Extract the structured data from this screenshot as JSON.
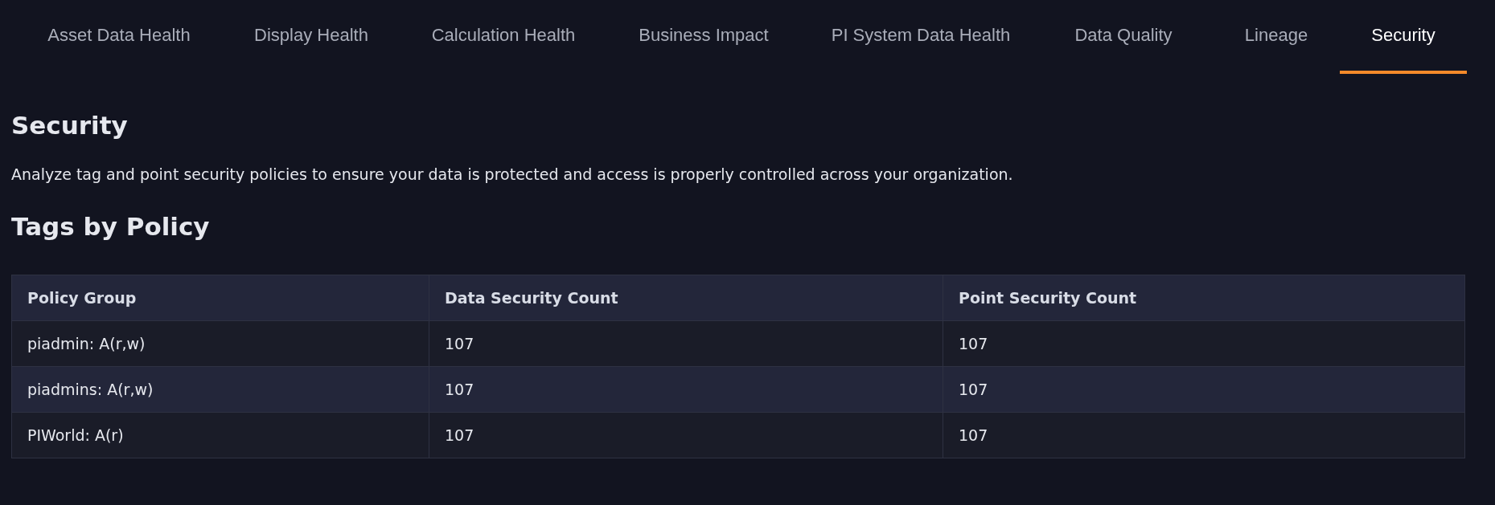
{
  "tabs": [
    {
      "label": "Asset Data Health",
      "selected": false
    },
    {
      "label": "Display Health",
      "selected": false
    },
    {
      "label": "Calculation Health",
      "selected": false
    },
    {
      "label": "Business Impact",
      "selected": false
    },
    {
      "label": "PI System Data Health",
      "selected": false
    },
    {
      "label": "Data Quality",
      "selected": false
    },
    {
      "label": "Lineage",
      "selected": false
    },
    {
      "label": "Security",
      "selected": true
    }
  ],
  "title": "Security",
  "description": "Analyze tag and point security policies to ensure your data is protected and access is properly controlled across your organization.",
  "section_title": "Tags by Policy",
  "table": {
    "columns": [
      "Policy Group",
      "Data Security Count",
      "Point Security Count"
    ],
    "rows": [
      [
        "piadmin: A(r,w)",
        "107",
        "107"
      ],
      [
        "piadmins: A(r,w)",
        "107",
        "107"
      ],
      [
        "PIWorld: A(r)",
        "107",
        "107"
      ]
    ]
  }
}
